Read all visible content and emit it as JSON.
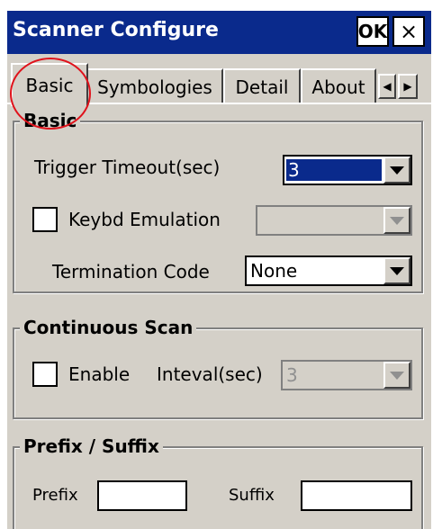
{
  "window": {
    "title": "Scanner Configure",
    "ok_label": "OK",
    "close_label": "×"
  },
  "tabs": [
    {
      "label": "Basic",
      "active": true
    },
    {
      "label": "Symbologies",
      "active": false
    },
    {
      "label": "Detail",
      "active": false
    },
    {
      "label": "About",
      "active": false
    }
  ],
  "tab_scroll": {
    "left_icon": "chevron-left-icon",
    "right_icon": "chevron-right-icon"
  },
  "basic": {
    "group_label": "Basic",
    "trigger_timeout_label": "Trigger Timeout(sec)",
    "trigger_timeout_value": "3",
    "keybd_emulation_label": "Keybd Emulation",
    "keybd_emulation_checked": false,
    "keybd_emulation_value": "",
    "termination_code_label": "Termination Code",
    "termination_code_value": "None"
  },
  "continuous_scan": {
    "group_label": "Continuous Scan",
    "enable_label": "Enable",
    "enable_checked": false,
    "interval_label": "Inteval(sec)",
    "interval_value": "3"
  },
  "prefix_suffix": {
    "group_label": "Prefix / Suffix",
    "prefix_label": "Prefix",
    "prefix_value": "",
    "suffix_label": "Suffix",
    "suffix_value": ""
  },
  "colors": {
    "titlebar": "#0a2a8c",
    "face": "#d4d0c8",
    "highlight_annotation": "#e0121b"
  }
}
